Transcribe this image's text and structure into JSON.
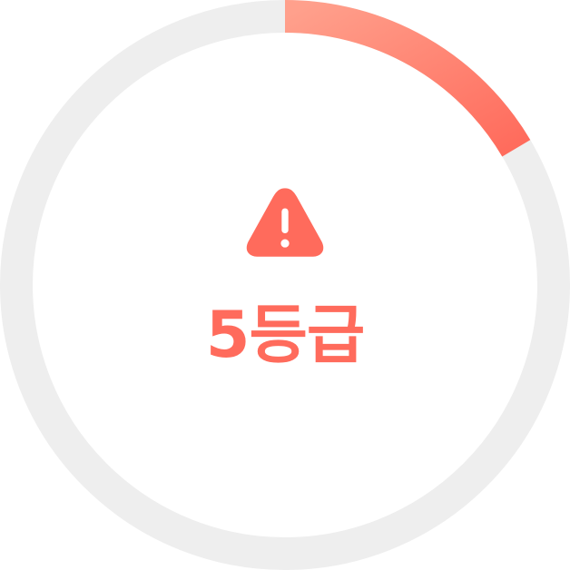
{
  "gauge": {
    "grade_label": "5등급",
    "progress_fraction": 0.165,
    "status_icon": "warning-triangle-icon",
    "colors": {
      "track": "#EEEEEE",
      "progress_start": "#FFA08C",
      "progress_end": "#FF6B5C",
      "accent": "#FF6B5C"
    }
  }
}
